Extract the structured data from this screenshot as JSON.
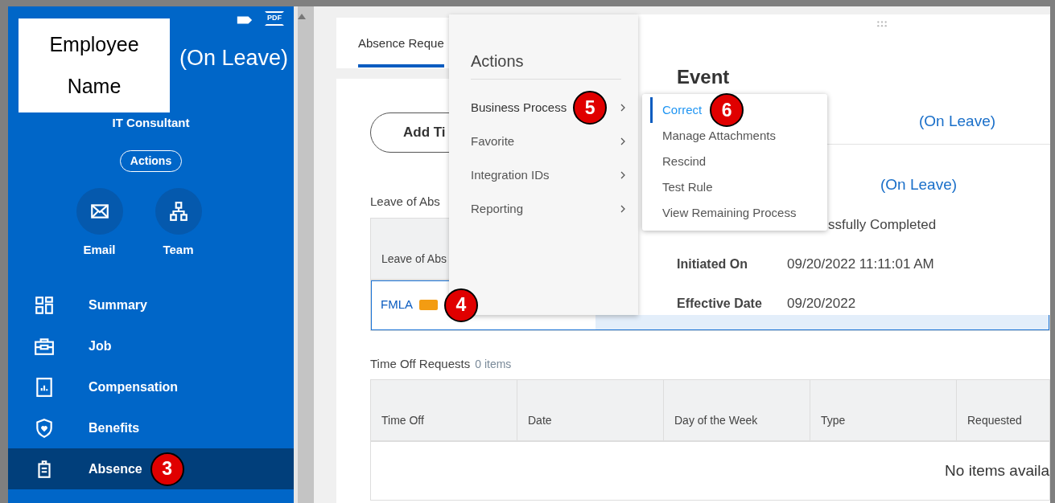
{
  "profile": {
    "name_lines": [
      "Employee",
      "Name"
    ],
    "status": "(On Leave)",
    "job_title": "IT Consultant",
    "actions_button": "Actions",
    "pdf_label": "PDF",
    "quick_actions": [
      {
        "label": "Email",
        "kind": "email"
      },
      {
        "label": "Team",
        "kind": "team"
      }
    ]
  },
  "sidebar": {
    "items": [
      {
        "label": "Summary",
        "kind": "summary",
        "selected": false
      },
      {
        "label": "Job",
        "kind": "job",
        "selected": false
      },
      {
        "label": "Compensation",
        "kind": "compensation",
        "selected": false
      },
      {
        "label": "Benefits",
        "kind": "benefits",
        "selected": false
      },
      {
        "label": "Absence",
        "kind": "absence",
        "selected": true,
        "callout": "3"
      }
    ]
  },
  "tabs": [
    {
      "label": "Absence Reque",
      "selected": true
    }
  ],
  "add_button": "Add Ti",
  "leave_section": {
    "title": "Leave of Abs",
    "columns": [
      "Leave of Abs"
    ],
    "rows": [
      {
        "type": "FMLA",
        "selected": true,
        "callout": "4"
      }
    ]
  },
  "time_off": {
    "title": "Time Off Requests",
    "count": "0 items",
    "columns": [
      "Time Off",
      "Date",
      "Day of the Week",
      "Type",
      "Requested"
    ],
    "empty_text": "No items availa"
  },
  "actions_menu": {
    "title": "Actions",
    "items": [
      {
        "label": "Business Process",
        "expanded": true,
        "callout": "5"
      },
      {
        "label": "Favorite",
        "expanded": false
      },
      {
        "label": "Integration IDs",
        "expanded": false
      },
      {
        "label": "Reporting",
        "expanded": false
      }
    ]
  },
  "event": {
    "title": "Event",
    "rows": [
      {
        "kind": "link",
        "value": "(On Leave)"
      },
      {
        "kind": "link",
        "value": "(On Leave)"
      },
      {
        "kind": "text",
        "value": "ssfully Completed"
      },
      {
        "kind": "field",
        "label": "Initiated On",
        "value": "09/20/2022 11:11:01 AM"
      },
      {
        "kind": "field",
        "label": "Effective Date",
        "value": "09/20/2022"
      }
    ]
  },
  "submenu": {
    "items": [
      {
        "label": "Correct",
        "selected": true,
        "callout": "6"
      },
      {
        "label": "Manage Attachments",
        "selected": false
      },
      {
        "label": "Rescind",
        "selected": false
      },
      {
        "label": "Test Rule",
        "selected": false
      },
      {
        "label": "View Remaining Process",
        "selected": false
      }
    ]
  }
}
